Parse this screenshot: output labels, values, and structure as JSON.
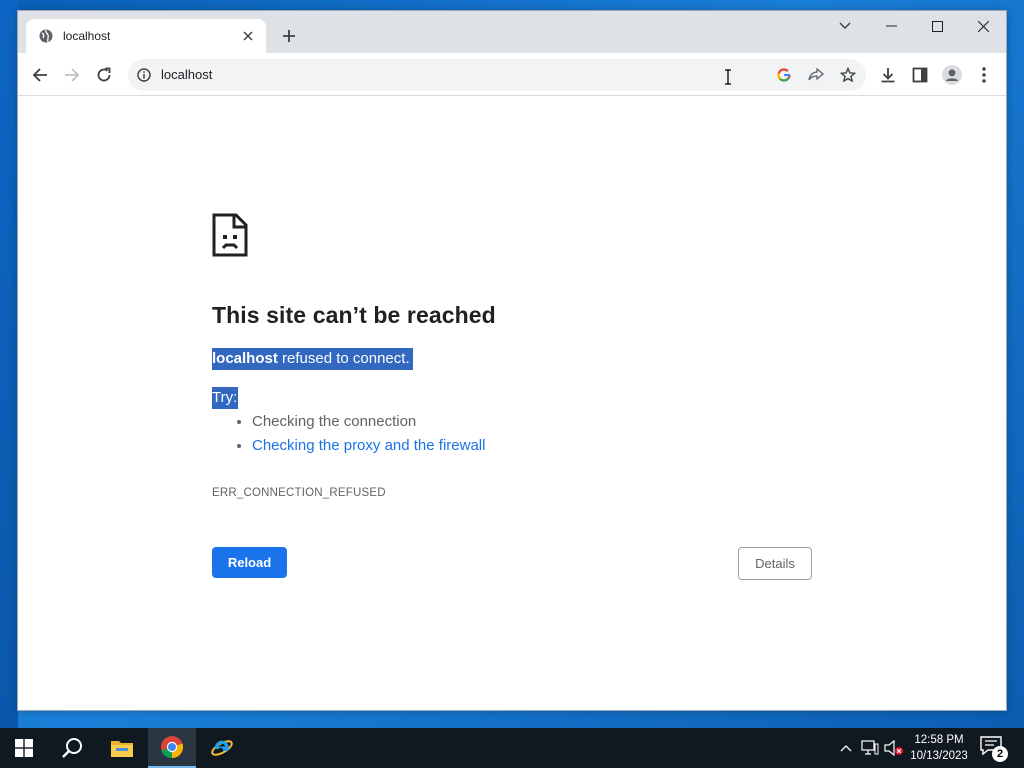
{
  "browser": {
    "tab": {
      "title": "localhost"
    },
    "address_bar": {
      "url": "localhost"
    }
  },
  "error_page": {
    "title": "This site can’t be reached",
    "description": {
      "host": "localhost",
      "message": " refused to connect."
    },
    "try_label": "Try:",
    "suggestions": [
      {
        "text": "Checking the connection",
        "link": false
      },
      {
        "text": "Checking the proxy and the firewall",
        "link": true
      }
    ],
    "error_code": "ERR_CONNECTION_REFUSED",
    "reload_label": "Reload",
    "details_label": "Details"
  },
  "taskbar": {
    "clock": {
      "time": "12:58 PM",
      "date": "10/13/2023"
    },
    "notification_count": "2"
  },
  "colors": {
    "accent": "#1a73e8",
    "selection": "#3268c0",
    "taskbar": "#101820"
  }
}
